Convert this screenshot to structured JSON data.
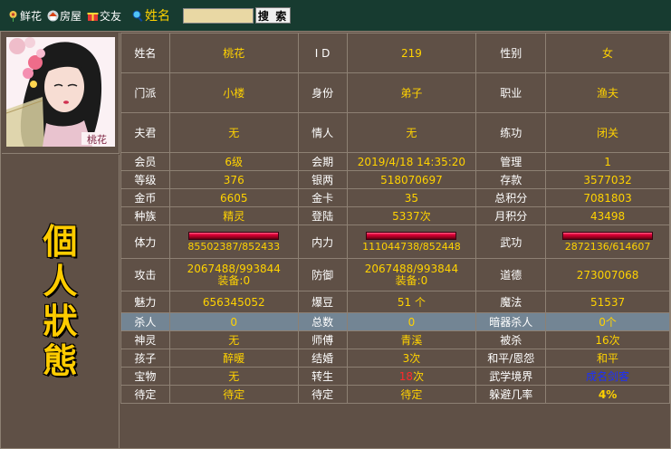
{
  "nav": {
    "items": [
      {
        "icon": "flower-icon",
        "label": "鲜花"
      },
      {
        "icon": "house-icon",
        "label": "房屋"
      },
      {
        "icon": "gift-icon",
        "label": "交友"
      },
      {
        "icon": "magnifier-icon",
        "label": "姓名"
      }
    ],
    "search_value": "",
    "search_button": "搜 索"
  },
  "avatar": {
    "caption": "桃花"
  },
  "status_title": [
    "個",
    "人",
    "狀",
    "態"
  ],
  "profile": {
    "name_label": "姓名",
    "name": "桃花",
    "id_label": "I D",
    "id": "219",
    "gender_label": "性别",
    "gender": "女",
    "sect_label": "门派",
    "sect": "小楼",
    "identity_label": "身份",
    "identity": "弟子",
    "job_label": "职业",
    "job": "渔夫",
    "husband_label": "夫君",
    "husband": "无",
    "lover_label": "情人",
    "lover": "无",
    "training_label": "练功",
    "training": "闭关"
  },
  "stats": {
    "member_label": "会员",
    "member": "6级",
    "term_label": "会期",
    "term": "2019/4/18 14:35:20",
    "manage_label": "管理",
    "manage": "1",
    "level_label": "等级",
    "level": "376",
    "silver_label": "银两",
    "silver": "518070697",
    "deposit_label": "存款",
    "deposit": "3577032",
    "gold_label": "金币",
    "gold": "6605",
    "goldcard_label": "金卡",
    "goldcard": "35",
    "total_points_label": "总积分",
    "total_points": "7081803",
    "race_label": "种族",
    "race": "精灵",
    "login_label": "登陆",
    "login": "5337次",
    "month_points_label": "月积分",
    "month_points": "43498",
    "hp_label": "体力",
    "hp": "85502387/852433",
    "mp_label": "内力",
    "mp": "111044738/852448",
    "martial_label": "武功",
    "martial": "2872136/614607",
    "attack_label": "攻击",
    "attack": "2067488/993844",
    "attack_equip": "装备:0",
    "defense_label": "防御",
    "defense": "2067488/993844",
    "defense_equip": "装备:0",
    "morality_label": "道德",
    "morality": "273007068",
    "charm_label": "魅力",
    "charm": "656345052",
    "beans_label": "爆豆",
    "beans": "51 个",
    "magic_label": "魔法",
    "magic": "51537",
    "kills_label": "杀人",
    "kills": "0",
    "total_label": "总数",
    "total": "0",
    "hidden_kills_label": "暗器杀人",
    "hidden_kills": "0个",
    "spirit_label": "神灵",
    "spirit": "无",
    "master_label": "师傅",
    "master": "青溪",
    "killed_label": "被杀",
    "killed": "16次",
    "child_label": "孩子",
    "child": "醉暖",
    "marriage_label": "结婚",
    "marriage": "3次",
    "peace_label": "和平/恩怨",
    "peace": "和平",
    "treasure_label": "宝物",
    "treasure": "无",
    "rebirth_label": "转生",
    "rebirth_num": "18",
    "rebirth_unit": "次",
    "realm_label": "武学境界",
    "realm": "成名剑客",
    "pending1_label": "待定",
    "pending1": "待定",
    "pending2_label": "待定",
    "pending2": "待定",
    "dodge_label": "躲避几率",
    "dodge": "4%"
  }
}
